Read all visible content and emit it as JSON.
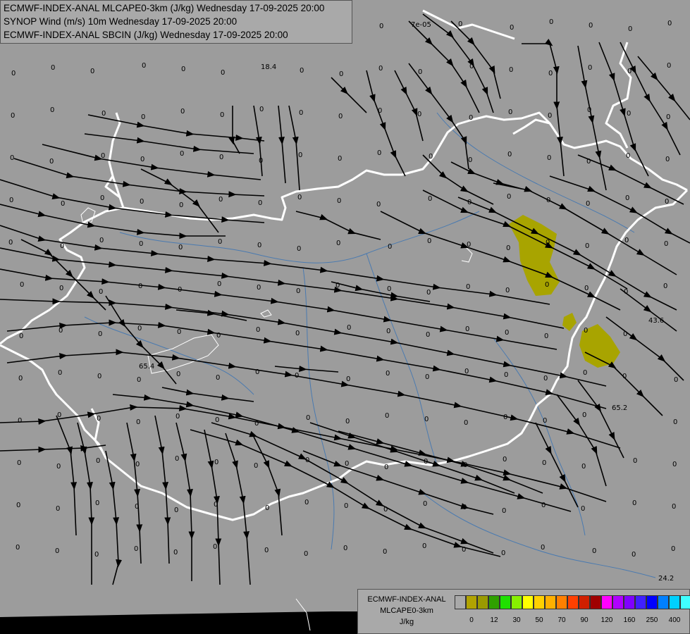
{
  "titles": {
    "line1": "ECMWF-INDEX-ANAL MLCAPE0-3km (J/kg) Wednesday 17-09-2025 20:00",
    "line2": "SYNOP Wind (m/s) 10m Wednesday 17-09-2025 20:00",
    "line3": "ECMWF-INDEX-ANAL SBCIN (J/kg) Wednesday 17-09-2025 20:00"
  },
  "legend": {
    "line1": "ECMWF-INDEX-ANAL",
    "line2": "MLCAPE0-3km",
    "line3": "J/kg",
    "colors": [
      "#a9a9a9",
      "#b1a300",
      "#9a9a00",
      "#2fa000",
      "#1fe000",
      "#88f000",
      "#ffff00",
      "#ffd000",
      "#ffb000",
      "#ff8000",
      "#ff4000",
      "#d02000",
      "#a00000",
      "#ff00ff",
      "#b000ff",
      "#8000ff",
      "#4020ff",
      "#0000ff",
      "#0080ff",
      "#00d0ff",
      "#40ffff",
      "#ffffff"
    ],
    "tick_labels": [
      "0",
      "12",
      "30",
      "50",
      "70",
      "90",
      "120",
      "160",
      "250",
      "400"
    ]
  },
  "colors": {
    "background": "#9c9c9c",
    "streamline": "#000000",
    "border": "#ffffff",
    "river": "#4a7ab0",
    "cape_fill": "#a8a400"
  },
  "sbcin_labels": [
    "0",
    "18.4",
    "7e-05",
    "65.4",
    "43.6",
    "65.2",
    "24.2"
  ]
}
